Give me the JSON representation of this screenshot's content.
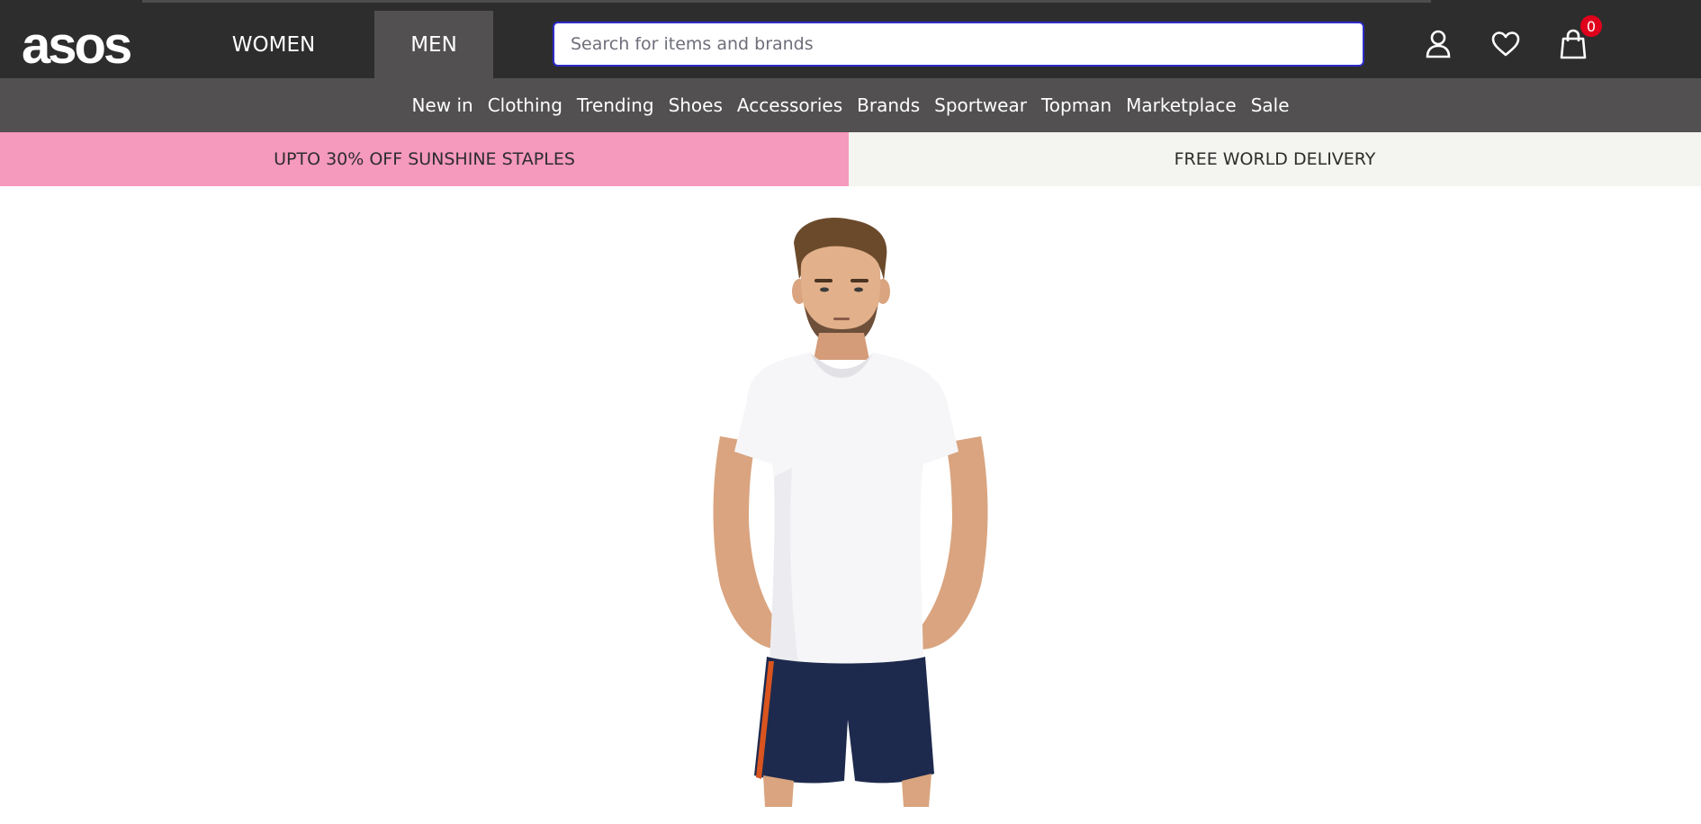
{
  "brand": {
    "logo_text": "asos"
  },
  "gender_tabs": [
    {
      "label": "WOMEN",
      "active": false
    },
    {
      "label": "MEN",
      "active": true
    }
  ],
  "search": {
    "placeholder": "Search for items and brands",
    "value": ""
  },
  "header_icons": {
    "account": "account-icon",
    "wishlist": "heart-icon",
    "bag": "bag-icon",
    "bag_count": "0"
  },
  "categories": [
    "New in",
    "Clothing",
    "Trending",
    "Shoes",
    "Accessories",
    "Brands",
    "Sportwear",
    "Topman",
    "Marketplace",
    "Sale"
  ],
  "promos": {
    "left": "UPTO 30% OFF SUNSHINE STAPLES",
    "right": "FREE WORLD DELIVERY"
  },
  "colors": {
    "topbar": "#2d2d2d",
    "category_bar": "#525050",
    "promo_pink": "#f599bd",
    "promo_neutral": "#f4f4f0",
    "badge": "#e0001b"
  }
}
